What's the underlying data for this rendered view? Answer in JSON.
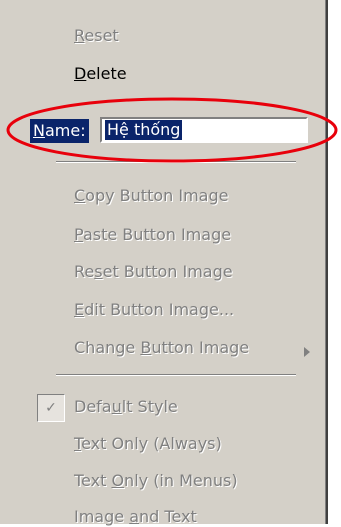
{
  "menu": {
    "reset": {
      "label": "Reset",
      "hotkey": "R",
      "rest": "eset"
    },
    "delete": {
      "label": "Delete",
      "hotkey": "D",
      "rest": "elete"
    },
    "name": {
      "label_hot": "N",
      "label_rest": "ame:",
      "value": "Hệ thống"
    },
    "copy_image": {
      "hotkey": "C",
      "rest": "opy Button Image"
    },
    "paste_image": {
      "hotkey": "P",
      "rest": "aste Button Image"
    },
    "reset_image": {
      "pre": "Re",
      "hotkey": "s",
      "rest": "et Button Image"
    },
    "edit_image": {
      "hotkey": "E",
      "rest": "dit Button Image..."
    },
    "change_image": {
      "pre": "Change ",
      "hotkey": "B",
      "rest": "utton Image"
    },
    "default_style": {
      "pre": "Defa",
      "hotkey": "u",
      "rest": "lt Style",
      "checked": true
    },
    "text_only_always": {
      "hotkey": "T",
      "rest": "ext Only (Always)"
    },
    "text_only_menus": {
      "pre": "Text ",
      "hotkey": "O",
      "rest": "nly (in Menus)"
    },
    "image_and_text": {
      "pre": "Image ",
      "hotkey": "a",
      "rest": "nd Text"
    }
  },
  "icons": {
    "checkmark": "check-icon",
    "submenu": "submenu-arrow-icon"
  },
  "colors": {
    "menu_bg": "#d4d0c8",
    "highlight": "#0a246a",
    "disabled_text": "#808080",
    "annotation": "#e8000b"
  }
}
